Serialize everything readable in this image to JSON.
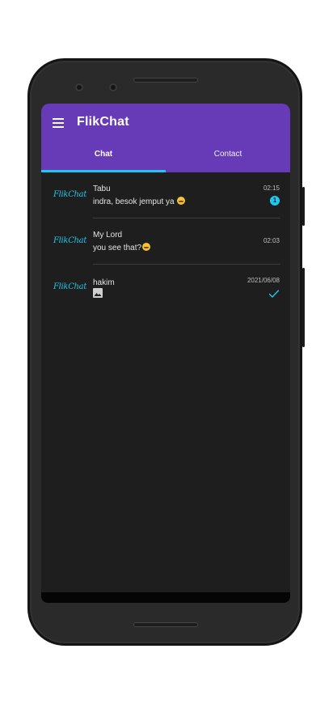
{
  "app": {
    "title": "FlikChat"
  },
  "tabs": [
    {
      "label": "Chat",
      "selected": true
    },
    {
      "label": "Contact",
      "selected": false
    }
  ],
  "chats": [
    {
      "avatar_text": "FlikChat",
      "name": "Tabu",
      "message": "indra, besok jemput ya",
      "emoji": "grinning-face-emoji",
      "time": "02:15",
      "unread": "1"
    },
    {
      "avatar_text": "FlikChat",
      "name": "My Lord",
      "message": "you see that?",
      "emoji": "grinning-face-emoji",
      "time": "02:03"
    },
    {
      "avatar_text": "FlikChat",
      "name": "hakim",
      "message_icon": "image-icon",
      "time": "2021/06/08",
      "status_icon": "check-icon"
    }
  ],
  "colors": {
    "app_bar": "#673ab7",
    "accent": "#1ec8f0",
    "background": "#1e1e1e"
  }
}
